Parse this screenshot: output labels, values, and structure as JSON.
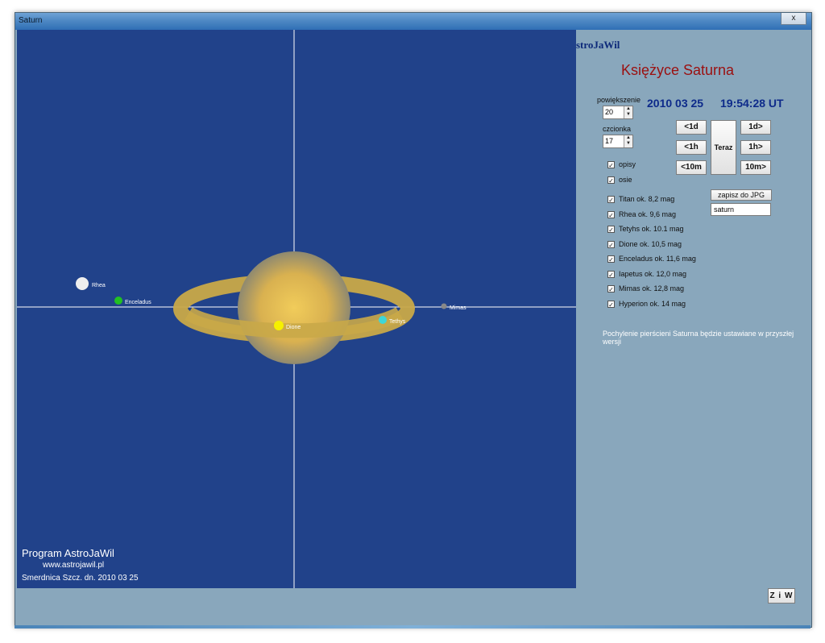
{
  "window": {
    "title": "Saturn",
    "close_label": "x"
  },
  "sky": {
    "moons": [
      {
        "name": "Rhea",
        "color": "#eeeeee"
      },
      {
        "name": "Enceladus",
        "color": "#22c022"
      },
      {
        "name": "Dione",
        "color": "#f6f000"
      },
      {
        "name": "Tethys",
        "color": "#3fd6d6"
      },
      {
        "name": "Mimas",
        "color": "#888888"
      }
    ],
    "credit_main": "Program AstroJaWil",
    "credit_url": "www.astrojawil.pl",
    "credit_place": "Smerdnica Szcz. dn.  2010 03 25"
  },
  "panel": {
    "brand": "stroJaWil",
    "title": "Księżyce Saturna",
    "zoom_label": "powiększenie",
    "zoom_value": "20",
    "font_label": "czcionka",
    "font_value": "17",
    "date": "2010 03 25",
    "time": "19:54:28 UT",
    "buttons": {
      "back_1d": "<1d",
      "fwd_1d": "1d>",
      "back_1h": "<1h",
      "fwd_1h": "1h>",
      "back_10m": "<10m",
      "fwd_10m": "10m>",
      "now": "Teraz"
    },
    "save_label": "zapisz do JPG",
    "filename": "saturn",
    "options": [
      {
        "label": "opisy",
        "checked": true
      },
      {
        "label": "osie",
        "checked": true
      }
    ],
    "moon_list": [
      {
        "label": "Titan   ok. 8,2 mag",
        "checked": true
      },
      {
        "label": "Rhea   ok. 9,6 mag",
        "checked": true
      },
      {
        "label": "Tetyhs   ok. 10.1 mag",
        "checked": true
      },
      {
        "label": "Dione    ok. 10,5 mag",
        "checked": true
      },
      {
        "label": "Enceladus    ok. 11,6 mag",
        "checked": true
      },
      {
        "label": "Iapetus   ok. 12,0 mag",
        "checked": true
      },
      {
        "label": "Mimas   ok. 12,8 mag",
        "checked": true
      },
      {
        "label": "Hyperion   ok. 14 mag",
        "checked": true
      }
    ],
    "note": "Pochylenie pierścieni Saturna będzie ustawiane w przyszłej wersji",
    "ziw_label": "Z i W"
  },
  "colors": {
    "sky": "#21428a",
    "planet": "#e8c050",
    "ring": "#c9a948",
    "panel": "#89a7bc",
    "title": "#9b1010",
    "datetime": "#0d2a8a"
  }
}
